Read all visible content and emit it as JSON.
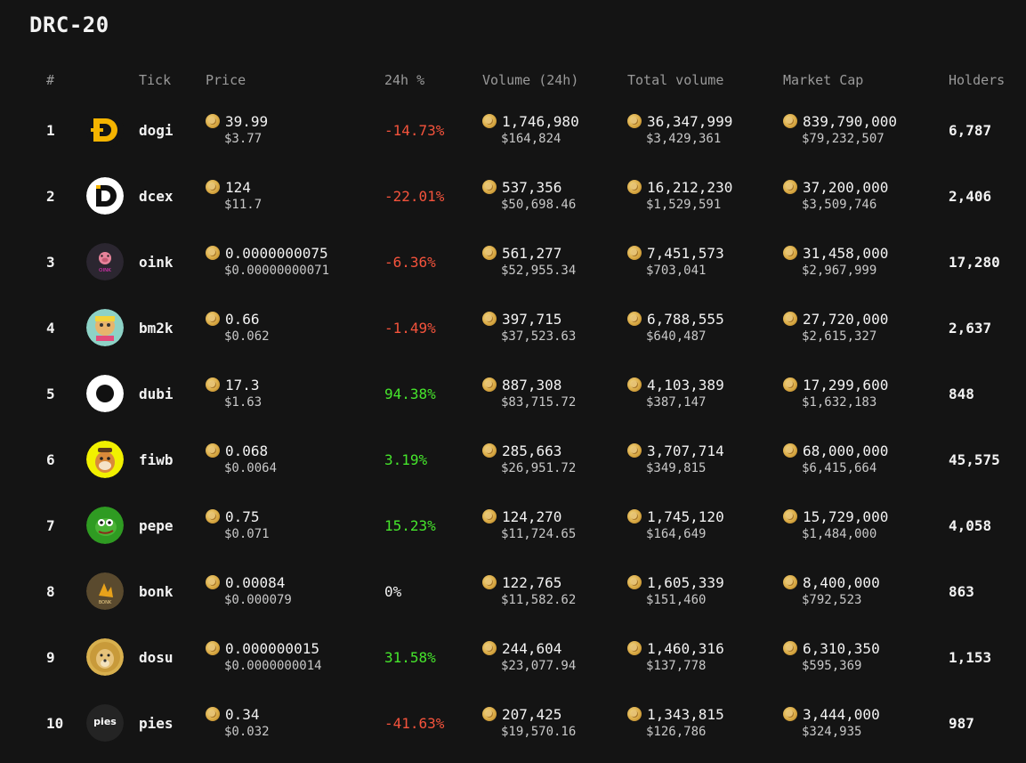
{
  "page": {
    "title": "DRC-20"
  },
  "columns": {
    "rank": "#",
    "tick": "Tick",
    "price": "Price",
    "change": "24h %",
    "volume": "Volume (24h)",
    "total_volume": "Total volume",
    "market_cap": "Market Cap",
    "holders": "Holders"
  },
  "colors": {
    "negative": "#f4533c",
    "positive": "#46e62c",
    "neutral": "#f2f2f2",
    "coin": "#d9a944"
  },
  "rows": [
    {
      "rank": "1",
      "tick": "dogi",
      "icon": "dogi-logo-icon",
      "price": "39.99",
      "price_usd": "$3.77",
      "change": "-14.73%",
      "trend": "negative",
      "volume": "1,746,980",
      "volume_usd": "$164,824",
      "total_volume": "36,347,999",
      "total_volume_usd": "$3,429,361",
      "market_cap": "839,790,000",
      "market_cap_usd": "$79,232,507",
      "holders": "6,787"
    },
    {
      "rank": "2",
      "tick": "dcex",
      "icon": "dcex-logo-icon",
      "price": "124",
      "price_usd": "$11.7",
      "change": "-22.01%",
      "trend": "negative",
      "volume": "537,356",
      "volume_usd": "$50,698.46",
      "total_volume": "16,212,230",
      "total_volume_usd": "$1,529,591",
      "market_cap": "37,200,000",
      "market_cap_usd": "$3,509,746",
      "holders": "2,406"
    },
    {
      "rank": "3",
      "tick": "oink",
      "icon": "oink-logo-icon",
      "price": "0.0000000075",
      "price_usd": "$0.00000000071",
      "change": "-6.36%",
      "trend": "negative",
      "volume": "561,277",
      "volume_usd": "$52,955.34",
      "total_volume": "7,451,573",
      "total_volume_usd": "$703,041",
      "market_cap": "31,458,000",
      "market_cap_usd": "$2,967,999",
      "holders": "17,280"
    },
    {
      "rank": "4",
      "tick": "bm2k",
      "icon": "bm2k-logo-icon",
      "price": "0.66",
      "price_usd": "$0.062",
      "change": "-1.49%",
      "trend": "negative",
      "volume": "397,715",
      "volume_usd": "$37,523.63",
      "total_volume": "6,788,555",
      "total_volume_usd": "$640,487",
      "market_cap": "27,720,000",
      "market_cap_usd": "$2,615,327",
      "holders": "2,637"
    },
    {
      "rank": "5",
      "tick": "dubi",
      "icon": "dubi-logo-icon",
      "price": "17.3",
      "price_usd": "$1.63",
      "change": "94.38%",
      "trend": "positive",
      "volume": "887,308",
      "volume_usd": "$83,715.72",
      "total_volume": "4,103,389",
      "total_volume_usd": "$387,147",
      "market_cap": "17,299,600",
      "market_cap_usd": "$1,632,183",
      "holders": "848"
    },
    {
      "rank": "6",
      "tick": "fiwb",
      "icon": "fiwb-logo-icon",
      "price": "0.068",
      "price_usd": "$0.0064",
      "change": "3.19%",
      "trend": "positive",
      "volume": "285,663",
      "volume_usd": "$26,951.72",
      "total_volume": "3,707,714",
      "total_volume_usd": "$349,815",
      "market_cap": "68,000,000",
      "market_cap_usd": "$6,415,664",
      "holders": "45,575"
    },
    {
      "rank": "7",
      "tick": "pepe",
      "icon": "pepe-logo-icon",
      "price": "0.75",
      "price_usd": "$0.071",
      "change": "15.23%",
      "trend": "positive",
      "volume": "124,270",
      "volume_usd": "$11,724.65",
      "total_volume": "1,745,120",
      "total_volume_usd": "$164,649",
      "market_cap": "15,729,000",
      "market_cap_usd": "$1,484,000",
      "holders": "4,058"
    },
    {
      "rank": "8",
      "tick": "bonk",
      "icon": "bonk-logo-icon",
      "price": "0.00084",
      "price_usd": "$0.000079",
      "change": "0%",
      "trend": "neutral",
      "volume": "122,765",
      "volume_usd": "$11,582.62",
      "total_volume": "1,605,339",
      "total_volume_usd": "$151,460",
      "market_cap": "8,400,000",
      "market_cap_usd": "$792,523",
      "holders": "863"
    },
    {
      "rank": "9",
      "tick": "dosu",
      "icon": "dosu-logo-icon",
      "price": "0.000000015",
      "price_usd": "$0.0000000014",
      "change": "31.58%",
      "trend": "positive",
      "volume": "244,604",
      "volume_usd": "$23,077.94",
      "total_volume": "1,460,316",
      "total_volume_usd": "$137,778",
      "market_cap": "6,310,350",
      "market_cap_usd": "$595,369",
      "holders": "1,153"
    },
    {
      "rank": "10",
      "tick": "pies",
      "icon": "pies-logo-icon",
      "logo_text": "pies",
      "price": "0.34",
      "price_usd": "$0.032",
      "change": "-41.63%",
      "trend": "negative",
      "volume": "207,425",
      "volume_usd": "$19,570.16",
      "total_volume": "1,343,815",
      "total_volume_usd": "$126,786",
      "market_cap": "3,444,000",
      "market_cap_usd": "$324,935",
      "holders": "987"
    }
  ]
}
